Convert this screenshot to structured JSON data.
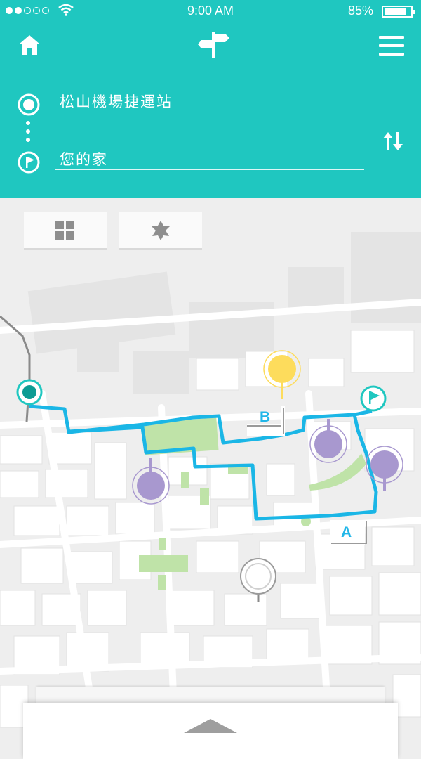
{
  "status_bar": {
    "time": "9:00  AM",
    "battery_percent": "85%",
    "signal_strength": 2,
    "battery_level": 0.85
  },
  "header": {
    "home_icon": "home-icon",
    "logo_icon": "signpost-icon",
    "menu_icon": "hamburger-menu-icon"
  },
  "route": {
    "origin": {
      "value": "松山機場捷運站",
      "icon": "origin-circle-icon"
    },
    "destination": {
      "value": "您的家",
      "icon": "flag-icon"
    },
    "swap_icon": "swap-arrows-icon"
  },
  "map": {
    "tools": [
      {
        "icon": "grid-icon"
      },
      {
        "icon": "star-icon"
      }
    ],
    "markers": {
      "label_a": "A",
      "label_b": "B"
    },
    "colors": {
      "accent": "#1fc7c0",
      "route": "#1ab6e6",
      "park": "#bfe3a8",
      "poi_purple": "#a898cf",
      "poi_yellow": "#fddc5c"
    }
  },
  "bottom_sheet": {
    "handle_icon": "chevron-up-icon"
  }
}
